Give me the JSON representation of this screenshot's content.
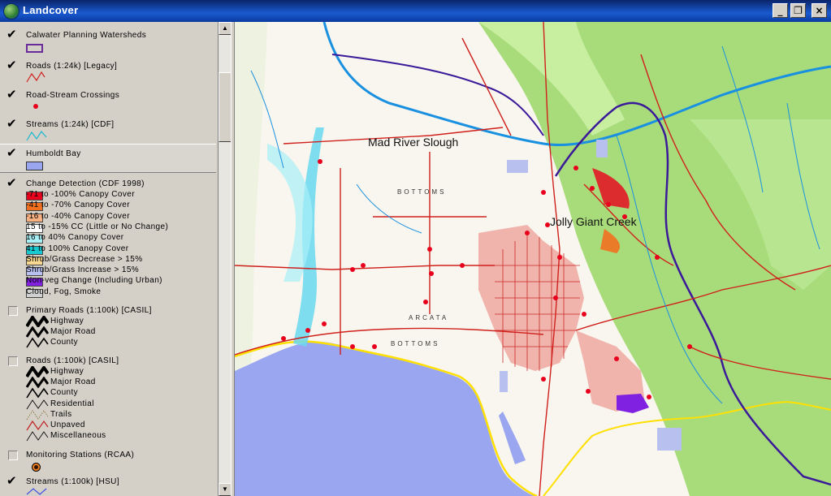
{
  "window": {
    "title": "Landcover",
    "minimize": "_",
    "restore": "❐",
    "close": "×"
  },
  "legend": {
    "layers": [
      {
        "name": "Calwater Planning Watersheds",
        "checked": true
      },
      {
        "name": "Roads (1:24k) [Legacy]",
        "checked": true
      },
      {
        "name": "Road-Stream Crossings",
        "checked": true
      },
      {
        "name": "Streams (1:24k) [CDF]",
        "checked": true
      },
      {
        "name": "Humboldt Bay",
        "checked": true
      },
      {
        "name": "Change Detection (CDF 1998)",
        "checked": true
      },
      {
        "name": "Primary Roads (1:100k) [CASIL]",
        "checked": false
      },
      {
        "name": "Roads (1:100k) [CASIL]",
        "checked": false
      },
      {
        "name": "Monitoring Stations (RCAA)",
        "checked": false
      },
      {
        "name": "Streams (1:100k) [HSU]",
        "checked": true
      }
    ],
    "change_classes": [
      {
        "label": "-71 to -100% Canopy Cover",
        "color": "#e8001c"
      },
      {
        "label": "-41 to -70% Canopy Cover",
        "color": "#f07020"
      },
      {
        "label": "-16 to -40% Canopy Cover",
        "color": "#f8b080"
      },
      {
        "label": "15 to -15% CC (Little or No Change)",
        "color": "#ffffff"
      },
      {
        "label": "16 to 40% Canopy Cover",
        "color": "#a8f0f8"
      },
      {
        "label": "41 to 100% Canopy Cover",
        "color": "#18c8d0"
      },
      {
        "label": "Shrub/Grass Decrease > 15%",
        "color": "#f8d890"
      },
      {
        "label": "Shrub/Grass Increase > 15%",
        "color": "#b8c0f0"
      },
      {
        "label": "Non-veg Change (Including Urban)",
        "color": "#8020e0"
      },
      {
        "label": "Cloud, Fog, Smoke",
        "color": "#d0d0d0"
      }
    ],
    "primary_roads": [
      "Highway",
      "Major Road",
      "County"
    ],
    "roads_100k": [
      "Highway",
      "Major Road",
      "County",
      "Residential",
      "Trails",
      "Unpaved",
      "Miscellaneous"
    ]
  },
  "map": {
    "labels": {
      "mad_river_slough": "Mad River Slough",
      "jolly_giant_creek": "Jolly Giant Creek",
      "bottoms_upper": "BOTTOMS",
      "bottoms_lower": "BOTTOMS",
      "arcata": "ARCATA"
    },
    "colors": {
      "water": "#9aa6f0",
      "forest": "#a8dc7a",
      "roads": "#d0201c",
      "streams": "#1a90e0",
      "watershed": "#3b1a9a",
      "urban": "#f0a8a0",
      "shoreline": "#ffe000"
    }
  }
}
